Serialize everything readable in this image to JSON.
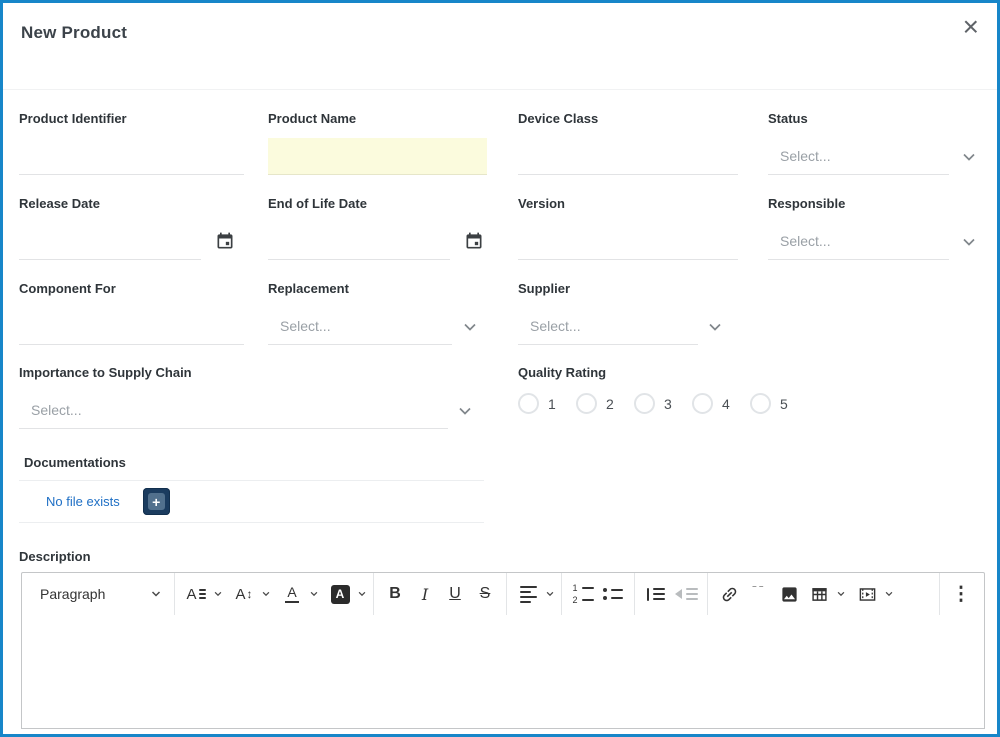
{
  "modal": {
    "title": "New Product",
    "close_glyph": "×",
    "accent_color": "#1786c9"
  },
  "form": {
    "product_identifier": {
      "label": "Product Identifier",
      "value": ""
    },
    "product_name": {
      "label": "Product Name",
      "value": "",
      "highlight_color": "#fbfbdd"
    },
    "device_class": {
      "label": "Device Class",
      "value": ""
    },
    "status": {
      "label": "Status",
      "placeholder": "Select..."
    },
    "release_date": {
      "label": "Release Date",
      "value": ""
    },
    "end_of_life_date": {
      "label": "End of Life Date",
      "value": ""
    },
    "version": {
      "label": "Version",
      "value": ""
    },
    "responsible": {
      "label": "Responsible",
      "placeholder": "Select..."
    },
    "component_for": {
      "label": "Component For",
      "value": ""
    },
    "replacement": {
      "label": "Replacement",
      "placeholder": "Select..."
    },
    "supplier": {
      "label": "Supplier",
      "placeholder": "Select..."
    },
    "importance": {
      "label": "Importance to Supply Chain",
      "placeholder": "Select..."
    },
    "quality_rating": {
      "label": "Quality Rating",
      "options": [
        "1",
        "2",
        "3",
        "4",
        "5"
      ]
    },
    "documentations": {
      "label": "Documentations",
      "empty_text": "No file exists",
      "add_glyph": "+",
      "link_color": "#1e6fc5",
      "button_color": "#1b3c5f"
    },
    "description": {
      "label": "Description"
    }
  },
  "editor": {
    "block_format": "Paragraph",
    "glyphs": {
      "font_family": "A",
      "font_size": "A",
      "font_size_arrow": "↕",
      "font_color": "A",
      "font_background": "A",
      "bold": "B",
      "italic": "I",
      "underline": "U",
      "strikethrough": "S",
      "quote": "“",
      "overflow": "⋮",
      "numbered_row_1": "1",
      "numbered_row_2": "2"
    }
  }
}
